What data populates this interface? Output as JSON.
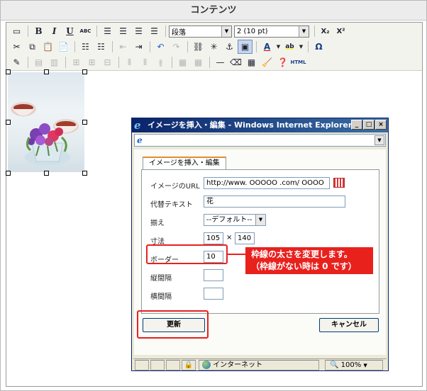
{
  "title": "コンテンツ",
  "toolbar": {
    "format_select": "段落",
    "size_select": "2 (10 pt)",
    "bold": "B",
    "italic": "I",
    "underline": "U",
    "strike": "ABC",
    "subscript": "X₂",
    "superscript": "X²",
    "omega": "Ω",
    "html": "HTML",
    "font_color": "A",
    "highlight": "ab"
  },
  "ie_window": {
    "title": "イメージを挿入・編集 - Windows Internet Explorer",
    "status_zone": "インターネット",
    "zoom": "100%"
  },
  "dialog": {
    "tab_label": "イメージを挿入・編集",
    "url_label": "イメージのURL",
    "url_value": "http://www. OOOOO .com/ OOOO",
    "alt_label": "代替テキスト",
    "alt_value": "花",
    "align_label": "揃え",
    "align_value": "--デフォルト--",
    "size_label": "寸法",
    "width_value": "105",
    "height_value": "140",
    "times": "×",
    "border_label": "ボーダー",
    "border_value": "10",
    "vspace_label": "縦間隔",
    "vspace_value": "",
    "hspace_label": "横間隔",
    "hspace_value": "",
    "update_button": "更新",
    "cancel_button": "キャンセル"
  },
  "callout": {
    "line1": "枠線の太さを変更します。",
    "line2": "（枠線がない時は 0 です）"
  },
  "colors": {
    "accent_red": "#e8211d",
    "ie_title_blue": "#0a246a"
  }
}
